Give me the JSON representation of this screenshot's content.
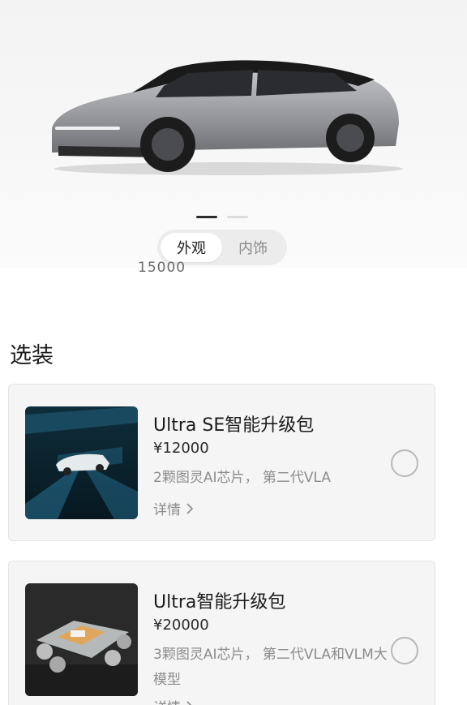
{
  "gallery": {
    "tabs": [
      {
        "label": "外观",
        "active": true
      },
      {
        "label": "内饰",
        "active": false
      }
    ],
    "page_count": 2,
    "active_page": 1
  },
  "partial_text": "15000",
  "options": {
    "title": "选装",
    "items": [
      {
        "title": "Ultra SE智能升级包",
        "price": "¥12000",
        "desc": "2颗图灵AI芯片， 第二代VLA",
        "link": "详情",
        "selected": false
      },
      {
        "title": "Ultra智能升级包",
        "price": "¥20000",
        "desc": "3颗图灵AI芯片， 第二代VLA和VLM大模型",
        "link": "详情",
        "selected": false
      }
    ]
  },
  "colors": {
    "car_body": "#9a9ca0",
    "roof": "#1a1a1a",
    "accent_blue": "#39a6d6"
  }
}
